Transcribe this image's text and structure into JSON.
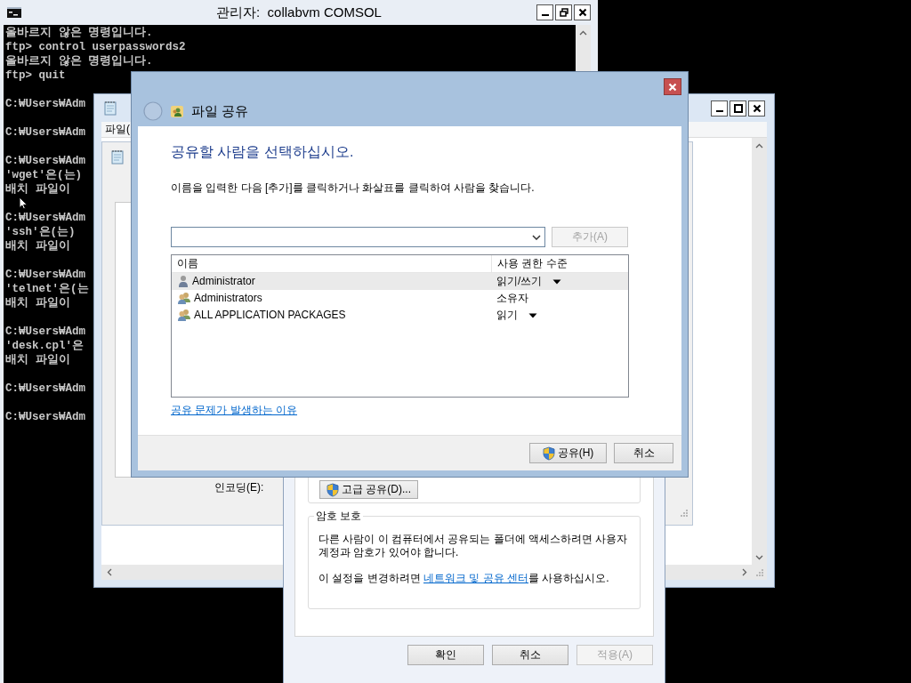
{
  "console": {
    "title": "관리자:  collabvm COMSOL",
    "blocks": [
      [
        "올바르지 않은 명령입니다.",
        "ftp> control userpasswords2",
        "올바르지 않은 명령입니다.",
        "ftp> quit"
      ],
      [
        "C:₩Users₩Adm"
      ],
      [
        "C:₩Users₩Adm"
      ],
      [
        "C:₩Users₩Adm",
        "'wget'은(는)",
        "배치 파일이"
      ],
      [
        "C:₩Users₩Adm",
        "'ssh'은(는)",
        "배치 파일이"
      ],
      [
        "C:₩Users₩Adm",
        "'telnet'은(는",
        "배치 파일이"
      ],
      [
        "C:₩Users₩Adm",
        "'desk.cpl'은",
        "배치 파일이"
      ],
      [
        "C:₩Users₩Adm"
      ],
      [
        "C:₩Users₩Adm"
      ]
    ]
  },
  "notepad": {
    "menu_item": "파일(",
    "save_dialog": {
      "encoding_label": "인코딩(E):"
    }
  },
  "properties": {
    "advanced_button": "고급 공유(D)...",
    "password_group": {
      "title": "암호 보호",
      "text": "다른 사람이 이 컴퓨터에서 공유되는 폴더에 액세스하려면 사용자 계정과 암호가 있어야 합니다.",
      "before": "이 설정을 변경하려면 ",
      "link": "네트워크 및 공유 센터",
      "after": "를 사용하십시오."
    },
    "buttons": [
      {
        "label": "확인",
        "disabled": false
      },
      {
        "label": "취소",
        "disabled": false
      },
      {
        "label": "적용(A)",
        "disabled": true
      }
    ]
  },
  "share_dialog": {
    "title": "파일 공유",
    "heading": "공유할 사람을 선택하십시오.",
    "instruction": "이름을 입력한 다음 [추가]를 클릭하거나 화살표를 클릭하여 사람을 찾습니다.",
    "add_button": {
      "label": "추가(A)",
      "disabled": true
    },
    "table": {
      "columns": [
        "이름",
        "사용 권한 수준"
      ],
      "rows": [
        {
          "kind": "user",
          "name": "Administrator",
          "permission": "읽기/쓰기",
          "dropdown": true,
          "selected": true
        },
        {
          "kind": "group",
          "name": "Administrators",
          "permission": "소유자",
          "dropdown": false,
          "selected": false
        },
        {
          "kind": "group",
          "name": "ALL APPLICATION PACKAGES",
          "permission": "읽기",
          "dropdown": true,
          "selected": false
        }
      ]
    },
    "help_link": "공유 문제가 발생하는 이유",
    "buttons": [
      {
        "kind": "elevated",
        "label": "공유(H)",
        "disabled": false
      },
      {
        "kind": "plain",
        "label": "취소",
        "disabled": false
      }
    ]
  }
}
